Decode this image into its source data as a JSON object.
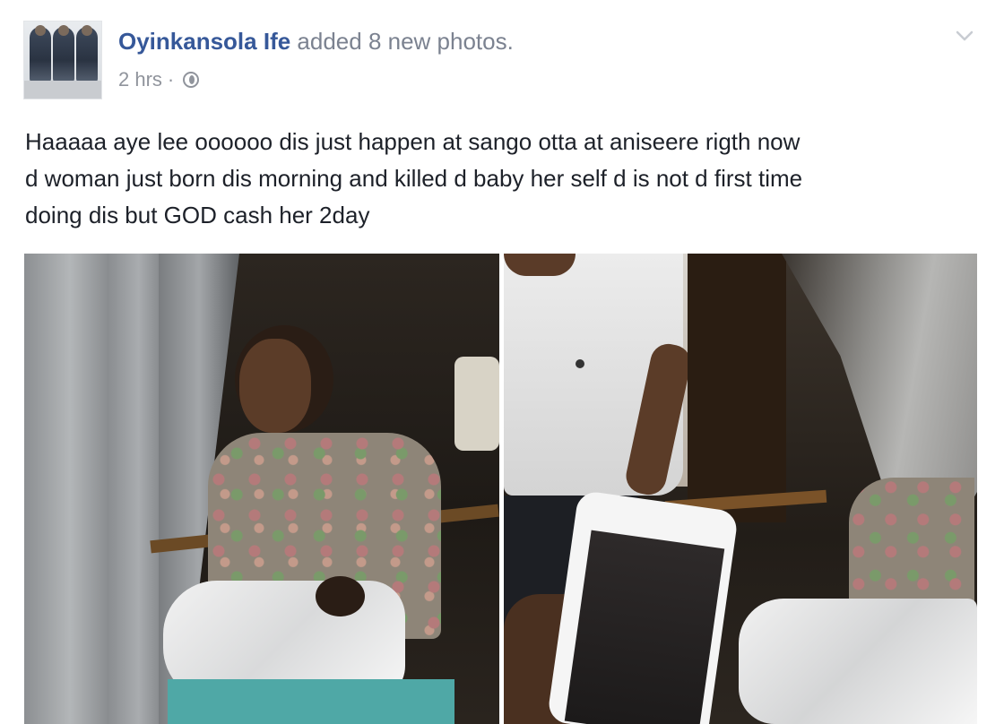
{
  "post": {
    "author": "Oyinkansola Ife",
    "action": "added 8 new photos.",
    "time": "2 hrs",
    "separator": "·",
    "privacy_icon": "globe-icon",
    "menu_icon": "chevron-down-icon",
    "text": "Haaaaa aye lee oooooo dis just happen at sango otta at aniseere rigth now\nd woman just born dis morning and killed d baby her self d is not d first time\ndoing dis but GOD cash her 2day"
  },
  "colors": {
    "author_link": "#365899",
    "meta_text": "#90949c",
    "body_text": "#1d2129"
  },
  "photos": [
    {
      "id": "photo-1"
    },
    {
      "id": "photo-2"
    }
  ]
}
